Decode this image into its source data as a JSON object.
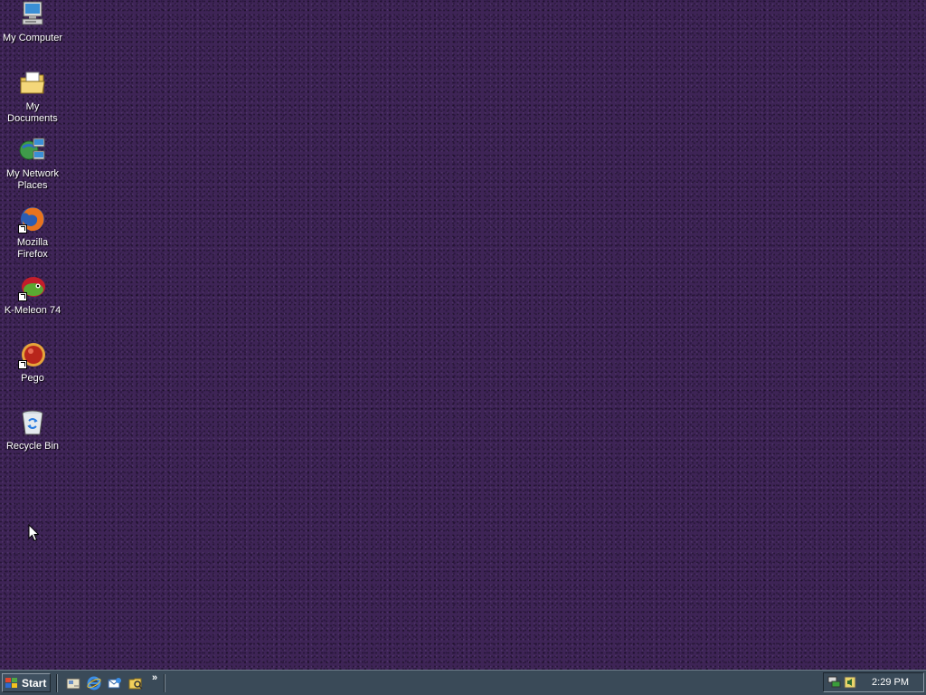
{
  "desktop": {
    "icons": [
      {
        "label": "My Computer",
        "icon": "my-computer-icon"
      },
      {
        "label": "My Documents",
        "icon": "my-documents-folder-icon"
      },
      {
        "label_line1": "My Network",
        "label_line2": "Places",
        "icon": "network-places-icon"
      },
      {
        "label": "Mozilla Firefox",
        "icon": "firefox-icon",
        "shortcut": true
      },
      {
        "label": "K-Meleon 74",
        "icon": "kmeleon-icon",
        "shortcut": true
      },
      {
        "label": "Pego",
        "icon": "pego-icon",
        "shortcut": true
      },
      {
        "label": "Recycle Bin",
        "icon": "recycle-bin-icon"
      }
    ],
    "background_color": "#3e2456"
  },
  "taskbar": {
    "start_label": "Start",
    "quick_launch": [
      {
        "icon": "show-desktop-icon"
      },
      {
        "icon": "internet-explorer-icon"
      },
      {
        "icon": "outlook-express-icon"
      },
      {
        "icon": "explorer-folder-icon"
      }
    ],
    "overflow_label": "»",
    "tray_icons": [
      "network-status-icon",
      "volume-icon"
    ],
    "clock": "2:29 PM"
  }
}
